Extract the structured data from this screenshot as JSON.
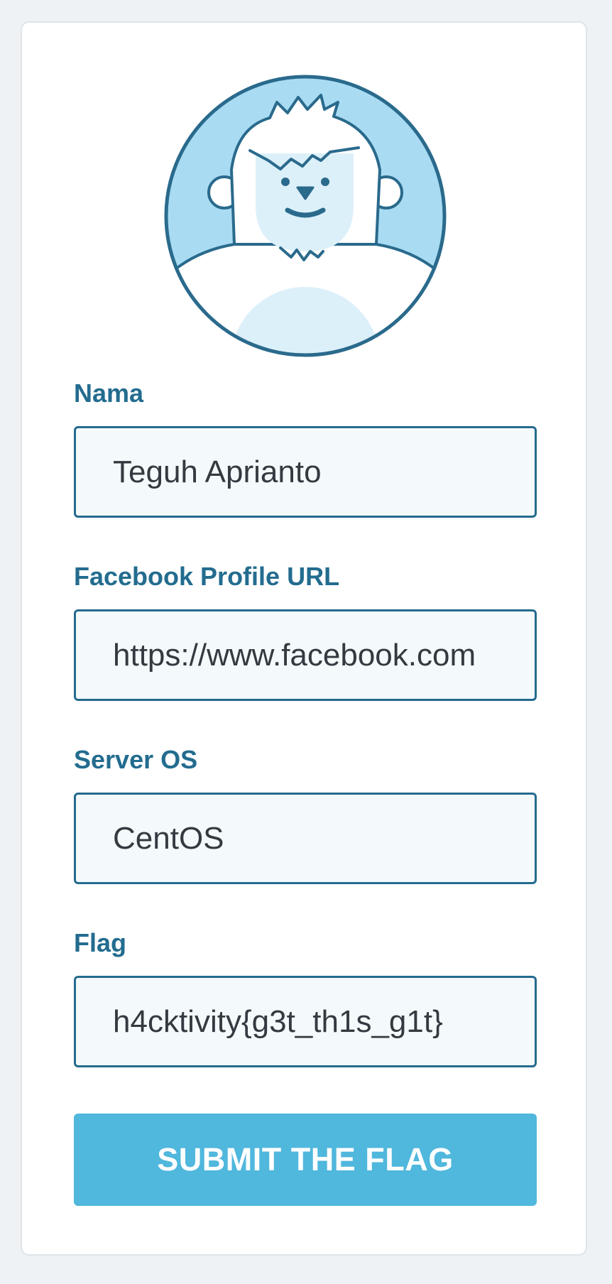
{
  "form": {
    "avatar": {
      "icon": "yeti-avatar-icon"
    },
    "fields": [
      {
        "label": "Nama",
        "value": "Teguh Aprianto"
      },
      {
        "label": "Facebook Profile URL",
        "value": "https://www.facebook.com"
      },
      {
        "label": "Server OS",
        "value": "CentOS"
      },
      {
        "label": "Flag",
        "value": "h4cktivity{g3t_th1s_g1t}"
      }
    ],
    "submit_label": "SUBMIT THE FLAG"
  },
  "colors": {
    "background": "#eef2f4",
    "card": "#ffffff",
    "label": "#236c8f",
    "input_border": "#246b8e",
    "input_background": "#f4f9fc",
    "button": "#50b7dd",
    "avatar_sky": "#a9dcf3",
    "avatar_outline": "#2a6a8c"
  }
}
